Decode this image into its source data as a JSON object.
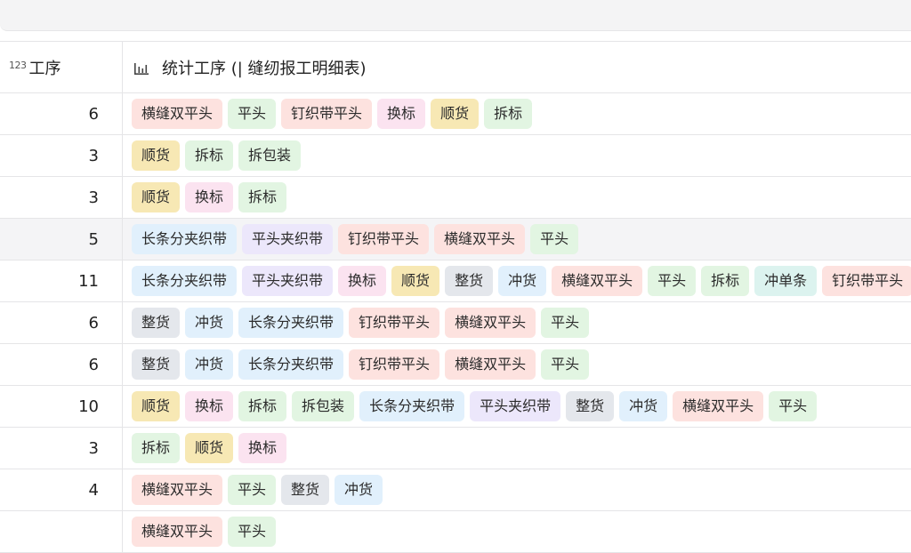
{
  "header": {
    "col1_icon_text": "123",
    "col1_label": "工序",
    "col2_label": "统计工序 (| 缝纫报工明细表)"
  },
  "tag_colors": {
    "横缝双平头": "#fde2df",
    "平头": "#e2f5e2",
    "钉织带平头": "#fde2df",
    "换标": "#fbe3f0",
    "顺货": "#f7e8b4",
    "拆标": "#e2f5e2",
    "拆包装": "#e2f5e2",
    "长条分夹织带": "#e1f0fc",
    "平头夹织带": "#ece7fb",
    "整货": "#e4e7ec",
    "冲货": "#e1f0fc",
    "冲单条": "#dcf3ef"
  },
  "rows": [
    {
      "count": "6",
      "tags": [
        "横缝双平头",
        "平头",
        "钉织带平头",
        "换标",
        "顺货",
        "拆标"
      ]
    },
    {
      "count": "3",
      "tags": [
        "顺货",
        "拆标",
        "拆包装"
      ]
    },
    {
      "count": "3",
      "tags": [
        "顺货",
        "换标",
        "拆标"
      ]
    },
    {
      "count": "5",
      "tags": [
        "长条分夹织带",
        "平头夹织带",
        "钉织带平头",
        "横缝双平头",
        "平头"
      ],
      "highlight": true
    },
    {
      "count": "11",
      "tags": [
        "长条分夹织带",
        "平头夹织带",
        "换标",
        "顺货",
        "整货",
        "冲货",
        "横缝双平头",
        "平头",
        "拆标",
        "冲单条",
        "钉织带平头"
      ]
    },
    {
      "count": "6",
      "tags": [
        "整货",
        "冲货",
        "长条分夹织带",
        "钉织带平头",
        "横缝双平头",
        "平头"
      ]
    },
    {
      "count": "6",
      "tags": [
        "整货",
        "冲货",
        "长条分夹织带",
        "钉织带平头",
        "横缝双平头",
        "平头"
      ]
    },
    {
      "count": "10",
      "tags": [
        "顺货",
        "换标",
        "拆标",
        "拆包装",
        "长条分夹织带",
        "平头夹织带",
        "整货",
        "冲货",
        "横缝双平头",
        "平头"
      ]
    },
    {
      "count": "3",
      "tags": [
        "拆标",
        "顺货",
        "换标"
      ]
    },
    {
      "count": "4",
      "tags": [
        "横缝双平头",
        "平头",
        "整货",
        "冲货"
      ]
    },
    {
      "count": "",
      "tags": [
        "横缝双平头",
        "平头"
      ]
    }
  ]
}
